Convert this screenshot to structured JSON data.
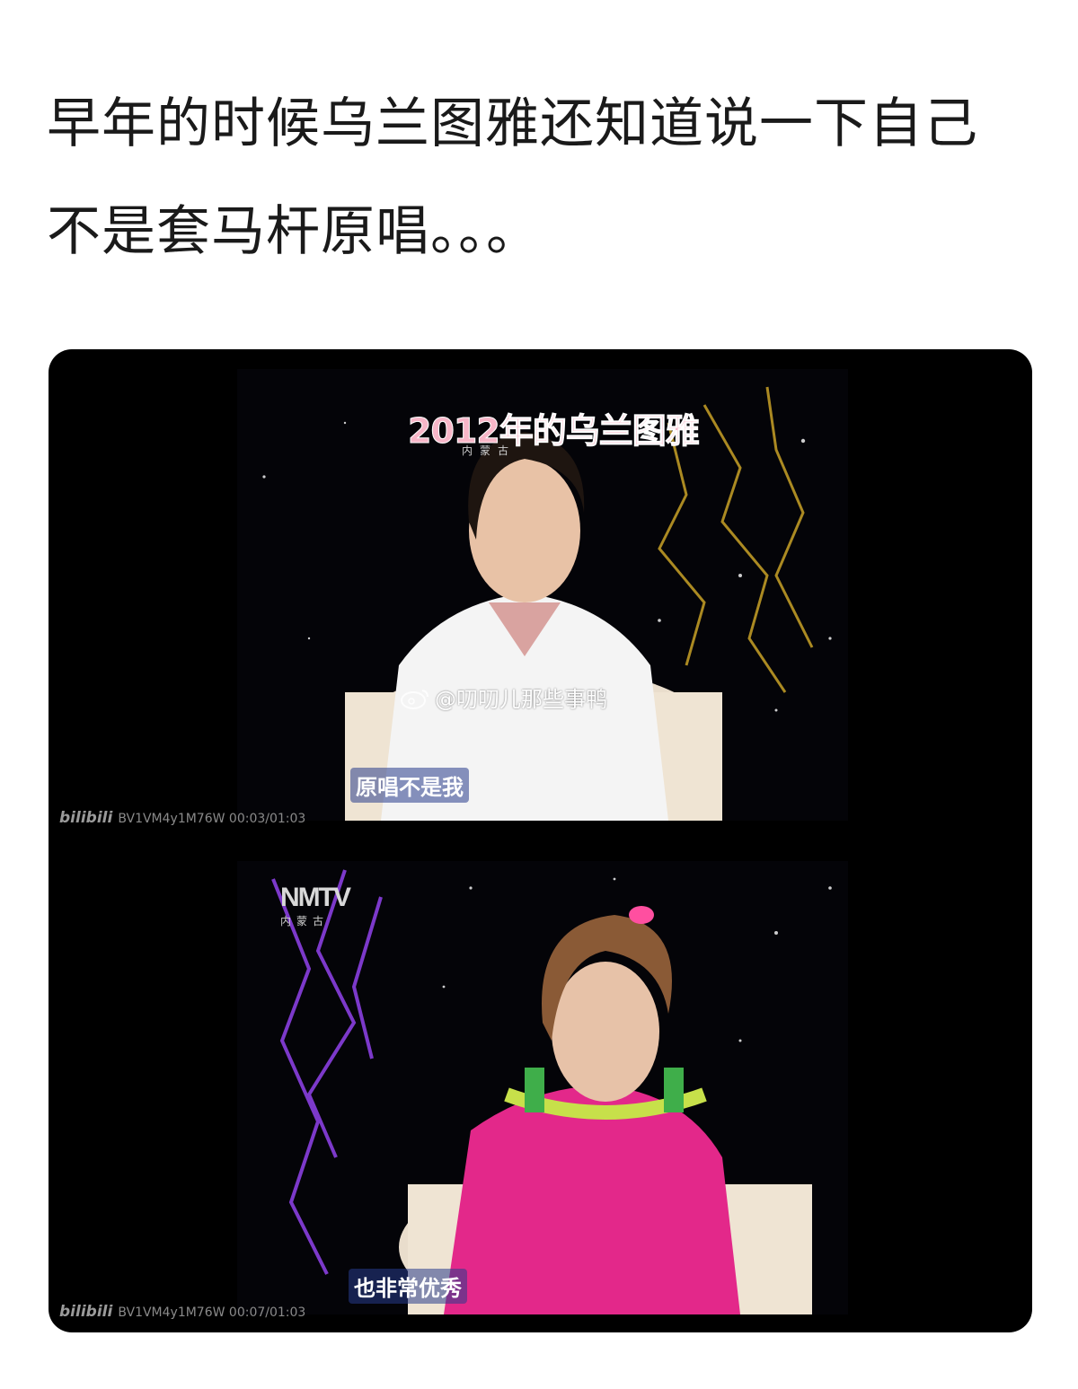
{
  "post": {
    "line1": "早年的时候乌兰图雅还知道说一下自己",
    "line2": "不是套马杆原唱。。。"
  },
  "video1": {
    "caption_tag": "2012年的乌兰图雅",
    "channel_small": "内蒙古",
    "subtitle": "原唱不是我",
    "bili_logo": "bilibili",
    "bili_info": "BV1VM4y1M76W 00:03/01:03"
  },
  "watermark": {
    "icon": "weibo-icon",
    "text": "@叨叨儿那些事鸭"
  },
  "video2": {
    "channel_logo": "NMTV",
    "channel_small": "内蒙古",
    "subtitle": "也非常优秀",
    "bili_logo": "bilibili",
    "bili_info": "BV1VM4y1M76W 00:07/01:03"
  },
  "colors": {
    "background": "#ffffff",
    "text": "#1a1a1a",
    "media_bg": "#000000",
    "caption_pink": "#f7b6c8"
  }
}
